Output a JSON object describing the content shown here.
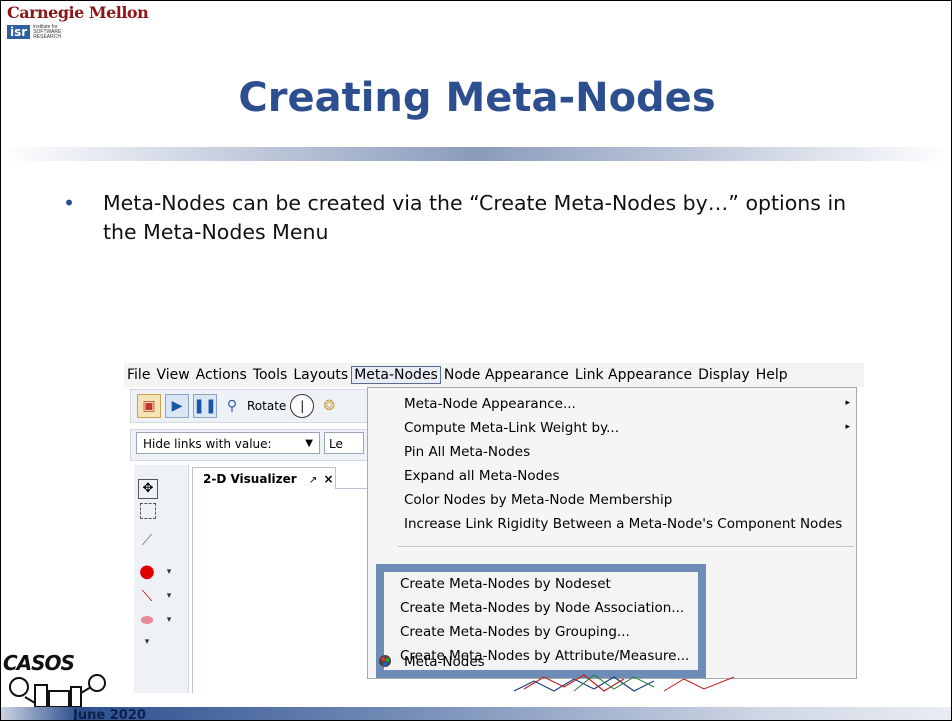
{
  "header": {
    "cmu_logo_text": "Carnegie Mellon",
    "isr_logo_text": "isr",
    "isr_subtext": "institute for SOFTWARE RESEARCH"
  },
  "title": "Creating Meta-Nodes",
  "bullets": [
    "Meta-Nodes can be created via the “Create Meta-Nodes by…” options in the Meta-Nodes Menu"
  ],
  "screenshot": {
    "menubar": [
      "File",
      "View",
      "Actions",
      "Tools",
      "Layouts",
      "Meta-Nodes",
      "Node Appearance",
      "Link Appearance",
      "Display",
      "Help"
    ],
    "active_menu": "Meta-Nodes",
    "toolbar": {
      "rotate_label": "Rotate",
      "filter_combo_value": "Hide links with value:",
      "second_combo_value": "Le"
    },
    "tab": {
      "label": "2-D Visualizer",
      "pin_glyph": "↗",
      "close_glyph": "×"
    },
    "menu_items": [
      {
        "label": "Meta-Node Appearance...",
        "submenu": true
      },
      {
        "label": "Compute Meta-Link Weight by...",
        "submenu": true
      },
      {
        "label": "Pin All Meta-Nodes",
        "submenu": false
      },
      {
        "label": "Expand all Meta-Nodes",
        "submenu": false
      },
      {
        "label": "Color Nodes by Meta-Node Membership",
        "submenu": false
      },
      {
        "label": "Increase Link Rigidity Between a Meta-Node's Component Nodes",
        "submenu": false
      }
    ],
    "highlighted_items": [
      "Create Meta-Nodes by Nodeset",
      "Create Meta-Nodes by Node Association...",
      "Create Meta-Nodes by Grouping...",
      "Create Meta-Nodes by Attribute/Measure..."
    ],
    "last_item": "Meta-Nodes",
    "submenu_arrow": "▸",
    "combo_arrow": "▼"
  },
  "footer": {
    "logo_text": "CASOS",
    "date": "June 2020"
  },
  "colors": {
    "title": "#2d4f8f",
    "highlight_border": "#6d8db8",
    "cmu_red": "#8c1515"
  }
}
